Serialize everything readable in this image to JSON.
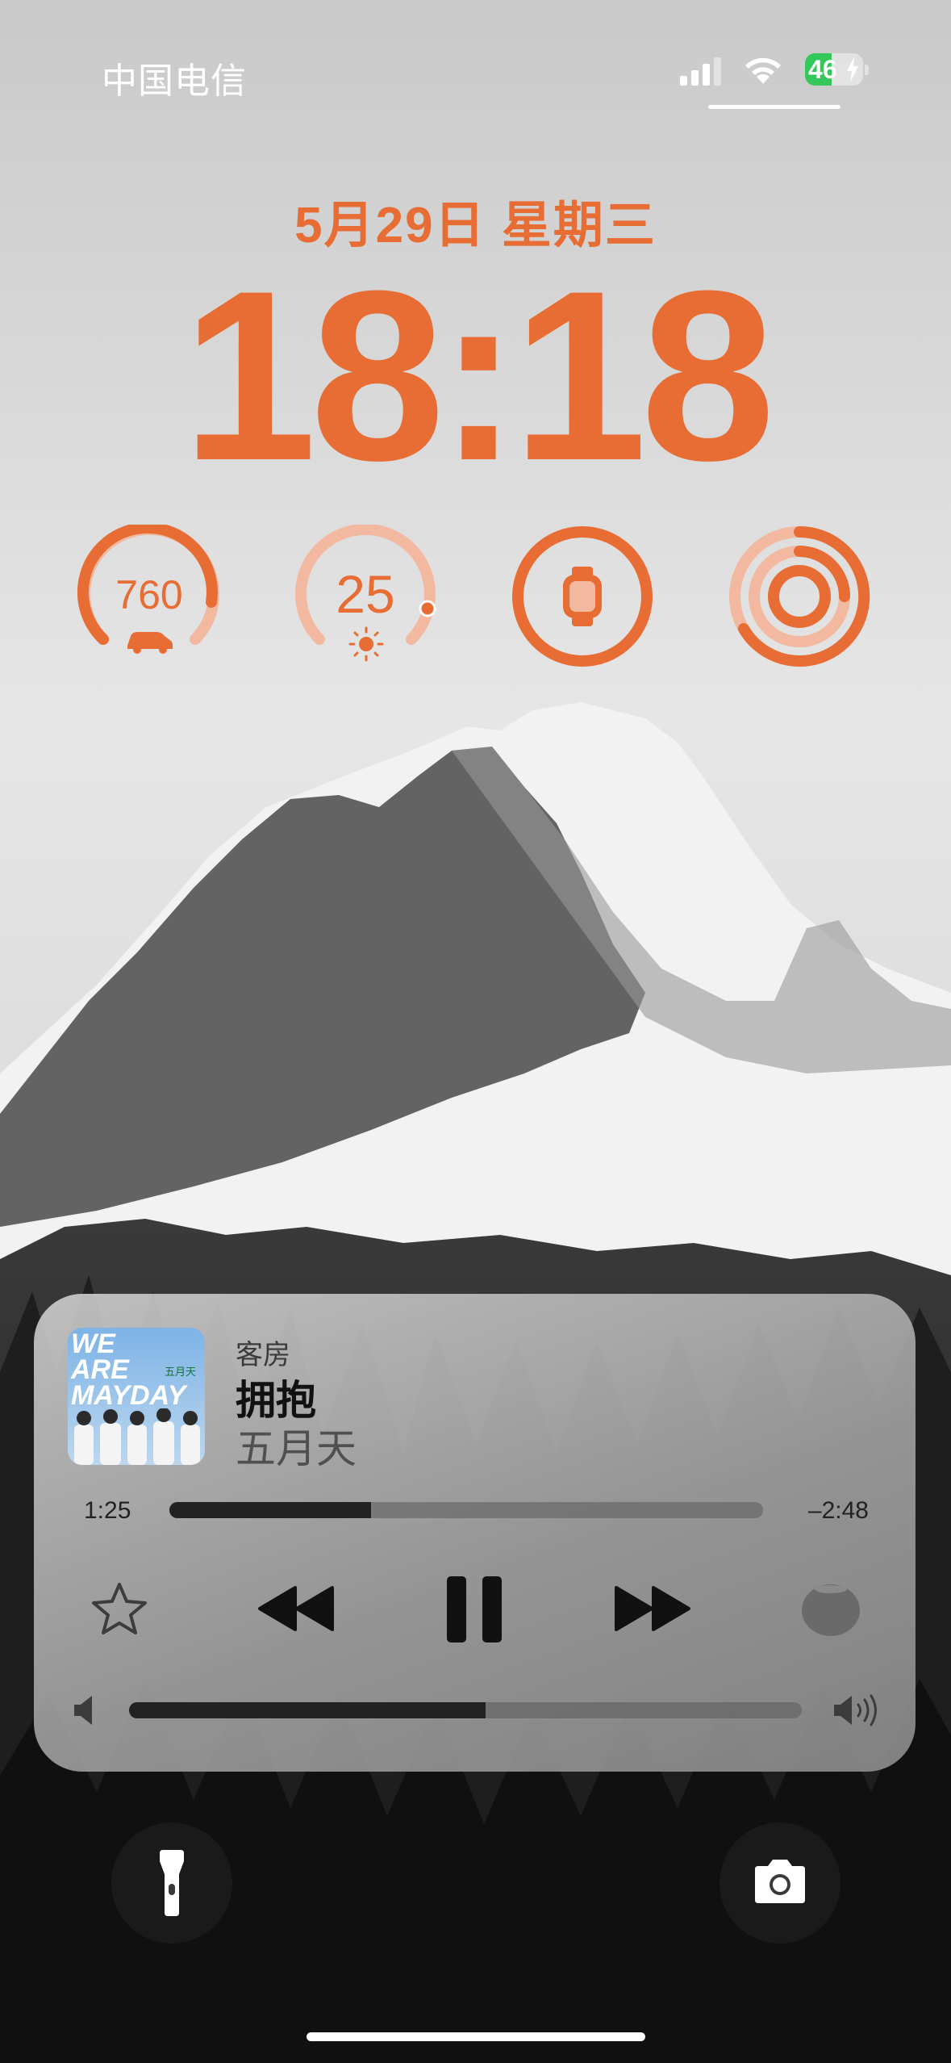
{
  "status": {
    "carrier": "中国电信",
    "battery": "46",
    "battery_level": 0.46,
    "battery_charging": true,
    "signal_bars": 3,
    "wifi_icon": "wifi-icon"
  },
  "lockscreen": {
    "date": "5月29日 星期三",
    "time": "18:18",
    "accent_color": "#e76d34"
  },
  "widgets": [
    {
      "name": "car-range",
      "value": "760",
      "icon": "car-icon",
      "level": 0.75
    },
    {
      "name": "weather",
      "value": "25",
      "icon": "sun-icon",
      "level": 0.7
    },
    {
      "name": "watch-battery",
      "icon": "watch-icon",
      "level": 1.0
    },
    {
      "name": "activity-rings",
      "icon": "activity-rings-icon"
    }
  ],
  "now_playing": {
    "route": "客房",
    "title": "拥抱",
    "artist": "五月天",
    "album_art_text": [
      "WE",
      "ARE",
      "MAYDAY"
    ],
    "album_art_subtitle": "五月天",
    "elapsed": "1:25",
    "remaining": "–2:48",
    "progress": 0.34,
    "volume": 0.53
  },
  "controls": {
    "favorite_icon": "star-icon",
    "previous_icon": "rewind-icon",
    "play_pause_icon": "pause-icon",
    "next_icon": "fast-forward-icon",
    "output_device_icon": "homepod-mini-icon"
  },
  "shortcuts": {
    "left_icon": "flashlight-icon",
    "right_icon": "camera-icon"
  }
}
